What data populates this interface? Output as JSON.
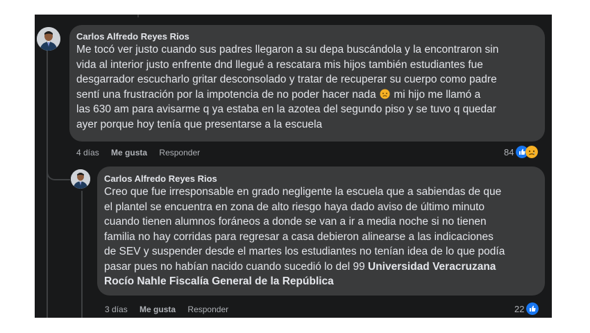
{
  "comments": [
    {
      "author": "Carlos Alfredo Reyes Rios",
      "lines": [
        "Me tocó ver justo cuando sus padres llegaron a su depa buscándola y la encontraron sin",
        "vida al interior justo enfrente dnd llegué a rescatara mis hijos también estudiantes fue",
        "desgarrador escucharlo gritar desconsolado y tratar de recuperar su cuerpo como padre"
      ],
      "line4_before_emoji": "sentí una frustración por la impotencia de no poder hacer nada",
      "line4_emoji": "sad-face-emoji",
      "line4_after_emoji": " mi hijo me llamó a",
      "lines_end": [
        "las 630 am para avisarme q ya estaba en la azotea del segundo piso y se tuvo q quedar",
        "ayer porque hoy tenía que presentarse a la escuela"
      ],
      "time": "4 días",
      "like_label": "Me gusta",
      "reply_label": "Responder",
      "reaction_count": "84",
      "reactions": [
        "like-reaction-icon",
        "sad-reaction-icon"
      ]
    },
    {
      "author": "Carlos Alfredo Reyes Rios",
      "lines": [
        "Creo que fue irresponsable en grado negligente la escuela que a sabiendas de que",
        "el plantel se encuentra en zona de alto riesgo haya dado aviso de último minuto",
        "cuando tienen alumnos foráneos a donde se van a ir a media noche si no tienen",
        "familia no hay corridas para regresar a casa debieron alinearse a las indicaciones",
        "de SEV y suspender desde el martes los estudiantes no tenían idea de lo que podía"
      ],
      "line6_text": "pasar pues no habían nacido cuando sucedió lo del 99 ",
      "mention1": "Universidad Veracruzana",
      "mention2": "Rocío Nahle",
      "mention3": "Fiscalía General de la República",
      "time": "3 días",
      "like_label": "Me gusta",
      "reply_label": "Responder",
      "reaction_count": "22",
      "reactions": [
        "like-reaction-icon"
      ]
    }
  ],
  "colors": {
    "background": "#18191a",
    "bubble": "#3a3b3c",
    "text": "#e4e6eb",
    "secondary": "#b0b3b8",
    "like_blue": "#1877f2",
    "sad_yellow": "#f7b125"
  }
}
